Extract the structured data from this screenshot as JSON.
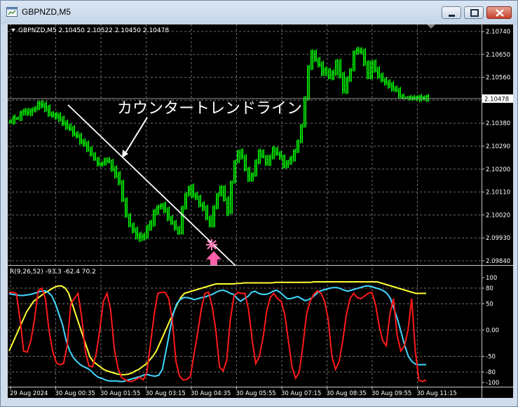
{
  "window": {
    "title": "GBPNZD,M5"
  },
  "chart": {
    "header": "GBPNZD,M5  2.10450 2.10522 2.10450 2.10478",
    "annotation": "カウンタートレンドライン",
    "current_price_label": "2.10478",
    "price_ticks": [
      "2.10740",
      "2.10650",
      "2.10560",
      "2.10470",
      "2.10380",
      "2.10290",
      "2.10200",
      "2.10110",
      "2.10020",
      "2.09930",
      "2.09840"
    ],
    "indicator_header": "R(9,26,52) -93.3 -62.4 70.2",
    "indicator_ticks": [
      "100",
      "80",
      "50",
      "0.00",
      "-50",
      "-80",
      "-100"
    ],
    "time_ticks": [
      "29 Aug 2024",
      "30 Aug 00:35",
      "30 Aug 01:55",
      "30 Aug 03:15",
      "30 Aug 04:35",
      "30 Aug 05:55",
      "30 Aug 07:15",
      "30 Aug 08:35",
      "30 Aug 09:55",
      "30 Aug 11:15"
    ]
  },
  "chart_data": {
    "type": "line",
    "price": {
      "ylim": [
        2.0984,
        2.1074
      ],
      "x": [
        0,
        5,
        10,
        15,
        20,
        25,
        30,
        35,
        40,
        45,
        50,
        55,
        60,
        65,
        70,
        75,
        80,
        85,
        90,
        95,
        100,
        105,
        110,
        115,
        120,
        125,
        130,
        135,
        140,
        145,
        150,
        155,
        160,
        165,
        170,
        175,
        180,
        185,
        190,
        195,
        200,
        205,
        210,
        215,
        220,
        225,
        230,
        235,
        240,
        245,
        250,
        255,
        260,
        265,
        270,
        275,
        280,
        285,
        290,
        295,
        300,
        305,
        310,
        315,
        320,
        325,
        330,
        335,
        340,
        345,
        350,
        355,
        360,
        365,
        370,
        375,
        380,
        385,
        390,
        395,
        400,
        405,
        410,
        415,
        420,
        425,
        430,
        435,
        440,
        445,
        450,
        455,
        460,
        465,
        470,
        475,
        480,
        485,
        490,
        495,
        500,
        505,
        510,
        515,
        520,
        525,
        530,
        535,
        540,
        545,
        550,
        555,
        560,
        565,
        570,
        575,
        580,
        585,
        590,
        595
      ],
      "close": [
        2.1039,
        2.104,
        2.104,
        2.1042,
        2.1043,
        2.1042,
        2.1043,
        2.1044,
        2.1046,
        2.1045,
        2.1044,
        2.1042,
        2.1041,
        2.1041,
        2.104,
        2.1038,
        2.1037,
        2.1036,
        2.1034,
        2.1033,
        2.1031,
        2.103,
        2.1028,
        2.1026,
        2.1024,
        2.1022,
        2.1022,
        2.1024,
        2.1023,
        2.102,
        2.1018,
        2.1015,
        2.1008,
        2.1002,
        2.0998,
        2.0996,
        2.0994,
        2.0993,
        2.0994,
        2.0997,
        2.0999,
        2.1003,
        2.1005,
        2.1006,
        2.1004,
        2.1001,
        2.0999,
        2.0997,
        2.0995,
        2.1005,
        2.101,
        2.1013,
        2.101,
        2.1009,
        2.1006,
        2.1005,
        2.1001,
        2.0998,
        2.1005,
        2.101,
        2.1013,
        2.1008,
        2.1003,
        2.1015,
        2.1023,
        2.1027,
        2.1025,
        2.102,
        2.1016,
        2.1018,
        2.1023,
        2.1027,
        2.1025,
        2.1022,
        2.1025,
        2.1028,
        2.1026,
        2.1025,
        2.1021,
        2.1023,
        2.1024,
        2.1027,
        2.1031,
        2.1037,
        2.1048,
        2.106,
        2.1066,
        2.1063,
        2.1061,
        2.1058,
        2.1059,
        2.1056,
        2.1058,
        2.1062,
        2.1057,
        2.1051,
        2.1055,
        2.1059,
        2.1066,
        2.1067,
        2.1066,
        2.1062,
        2.1056,
        2.1062,
        2.1059,
        2.1057,
        2.1055,
        2.1054,
        2.1053,
        2.1052,
        2.1051,
        2.1049,
        2.1048,
        2.1048,
        2.1048,
        2.1048,
        2.1048,
        2.1048,
        2.1048,
        2.1048
      ]
    },
    "indicator": {
      "ylim": [
        -100,
        100
      ],
      "fast_red": [
        72,
        72,
        70,
        22,
        -40,
        -42,
        -20,
        20,
        75,
        80,
        60,
        0,
        -40,
        -62,
        -66,
        -64,
        -30,
        50,
        60,
        70,
        25,
        -40,
        -68,
        -70,
        -45,
        0,
        55,
        70,
        38,
        -35,
        -72,
        -90,
        -95,
        -98,
        -98,
        -94,
        -90,
        -95,
        -80,
        -25,
        30,
        70,
        72,
        72,
        60,
        20,
        -60,
        -88,
        -95,
        -94,
        -88,
        -45,
        -5,
        40,
        70,
        72,
        45,
        0,
        -70,
        -78,
        -58,
        20,
        65,
        72,
        70,
        70,
        40,
        -18,
        -64,
        -50,
        -15,
        35,
        62,
        70,
        60,
        55,
        30,
        -20,
        -70,
        -92,
        -80,
        -30,
        30,
        55,
        68,
        75,
        70,
        55,
        20,
        -50,
        -75,
        -60,
        -20,
        30,
        60,
        70,
        62,
        60,
        65,
        70,
        72,
        50,
        10,
        -20,
        -30,
        30,
        60,
        -10,
        -40,
        -30,
        0,
        60,
        -40,
        -96,
        -98,
        -95
      ],
      "mid_cyan": [
        70,
        68,
        67,
        66,
        66,
        67,
        68,
        70,
        72,
        74,
        75,
        72,
        65,
        50,
        30,
        10,
        -20,
        -40,
        -52,
        -60,
        -66,
        -70,
        -73,
        -78,
        -85,
        -90,
        -92,
        -95,
        -97,
        -97,
        -97,
        -98,
        -98,
        -96,
        -94,
        -92,
        -90,
        -88,
        -85,
        -85,
        -87,
        -88,
        -86,
        -75,
        -40,
        -5,
        30,
        50,
        58,
        62,
        62,
        60,
        58,
        60,
        62,
        63,
        66,
        68,
        72,
        75,
        76,
        74,
        70,
        68,
        60,
        55,
        60,
        64,
        72,
        74,
        70,
        68,
        68,
        70,
        74,
        76,
        72,
        66,
        60,
        60,
        62,
        64,
        60,
        56,
        58,
        62,
        68,
        74,
        76,
        78,
        80,
        81,
        81,
        79,
        76,
        74,
        76,
        78,
        80,
        82,
        84,
        84,
        82,
        80,
        78,
        75,
        70,
        60,
        40,
        20,
        -5,
        -30,
        -50,
        -60,
        -65,
        -66,
        -66,
        -66
      ],
      "slow_yellow": [
        -40,
        -25,
        -10,
        5,
        20,
        35,
        45,
        55,
        60,
        65,
        70,
        74,
        78,
        82,
        84,
        84,
        80,
        70,
        50,
        30,
        10,
        -10,
        -30,
        -50,
        -60,
        -65,
        -70,
        -75,
        -78,
        -80,
        -82,
        -84,
        -85,
        -85,
        -84,
        -82,
        -78,
        -75,
        -70,
        -65,
        -58,
        -50,
        -40,
        -25,
        -10,
        5,
        20,
        35,
        50,
        62,
        70,
        72,
        74,
        76,
        78,
        80,
        82,
        84,
        86,
        88,
        88,
        88,
        88,
        88,
        88,
        89,
        89,
        90,
        90,
        90,
        90,
        90,
        90,
        90,
        90,
        90,
        91,
        91,
        91,
        91,
        91,
        91,
        91,
        91,
        91,
        91,
        91,
        92,
        92,
        92,
        92,
        92,
        92,
        92,
        92,
        92,
        92,
        92,
        92,
        92,
        92,
        92,
        92,
        92,
        92,
        92,
        90,
        88,
        86,
        84,
        82,
        80,
        78,
        76,
        74,
        72,
        70,
        70,
        70,
        70
      ]
    }
  }
}
